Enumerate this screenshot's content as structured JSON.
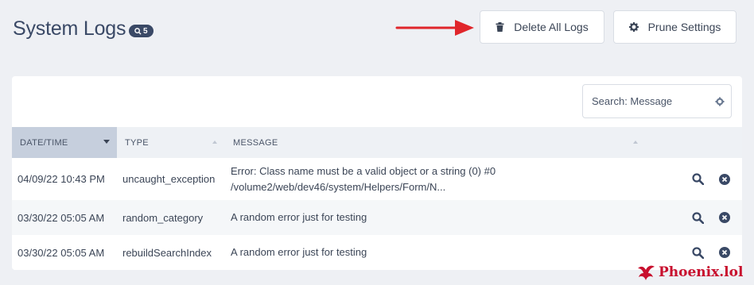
{
  "header": {
    "title": "System Logs",
    "count_badge": "5",
    "delete_all_label": "Delete All Logs",
    "prune_settings_label": "Prune Settings"
  },
  "search": {
    "label": "Search: Message"
  },
  "table": {
    "columns": [
      "DATE/TIME",
      "TYPE",
      "MESSAGE"
    ],
    "rows": [
      {
        "date": "04/09/22 10:43 PM",
        "type": "uncaught_exception",
        "message_line1": "Error: Class name must be a valid object or a string (0) #0",
        "message_line2": "/volume2/web/dev46/system/Helpers/Form/N..."
      },
      {
        "date": "03/30/22 05:05 AM",
        "type": "random_category",
        "message_line1": "A random error just for testing"
      },
      {
        "date": "03/30/22 05:05 AM",
        "type": "rebuildSearchIndex",
        "message_line1": "A random error just for testing"
      }
    ]
  },
  "watermark": {
    "text": "Phoenix.lol"
  },
  "colors": {
    "title": "#3a4966",
    "accent_arrow": "#e0262b",
    "header_sorted": "#c6cfdd",
    "watermark": "#c8102e"
  }
}
